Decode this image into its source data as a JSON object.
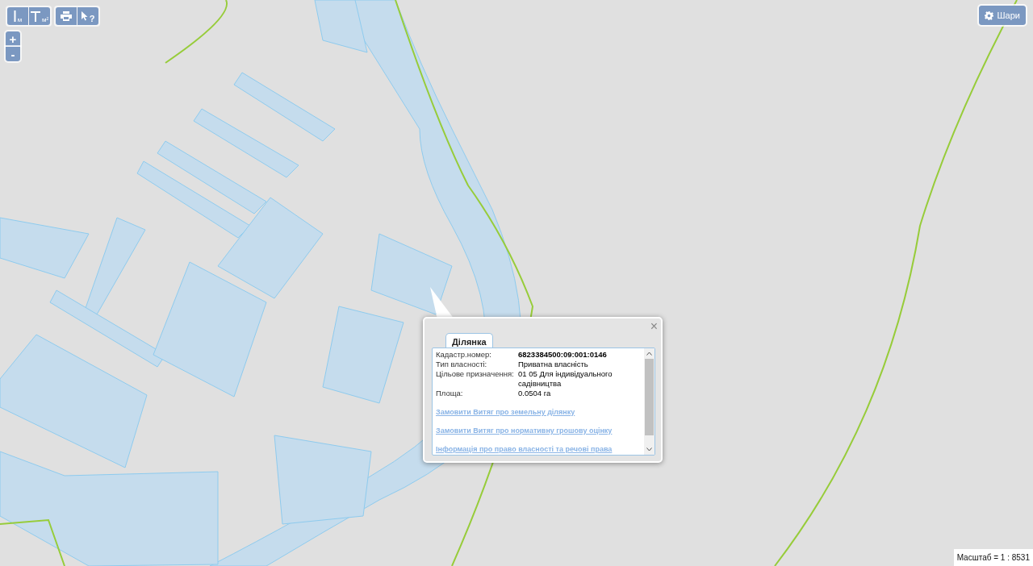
{
  "toolbar": {
    "groups": [
      [
        {
          "kind": "measure-length",
          "unit": "м"
        },
        {
          "kind": "measure-area",
          "unit": "м²"
        }
      ],
      [
        {
          "kind": "print"
        },
        {
          "kind": "identify",
          "unit": "?"
        }
      ]
    ]
  },
  "zoom": {
    "in": "+",
    "out": "-"
  },
  "layers_button": {
    "label": "Шари"
  },
  "popup": {
    "tab": {
      "label": "Ділянка",
      "selected": true
    },
    "close": "×",
    "fields": [
      {
        "label": "Кадастр.номер:",
        "value": "6823384500:09:001:0146",
        "bold": true
      },
      {
        "label": "Тип власності:",
        "value": "Приватна власність",
        "bold": false
      },
      {
        "label": "Цільове призначення:",
        "value": "01 05 Для індивідуального садівництва",
        "bold": false
      },
      {
        "label": "Площа:",
        "value": "0.0504 га",
        "bold": false
      }
    ],
    "links": [
      "Замовити Витяг про земельну ділянку",
      "Замовити Витяг про нормативну грошову оцінку",
      "Інформація про право власності та речові права"
    ]
  },
  "scale": "Масштаб = 1 : 8531"
}
